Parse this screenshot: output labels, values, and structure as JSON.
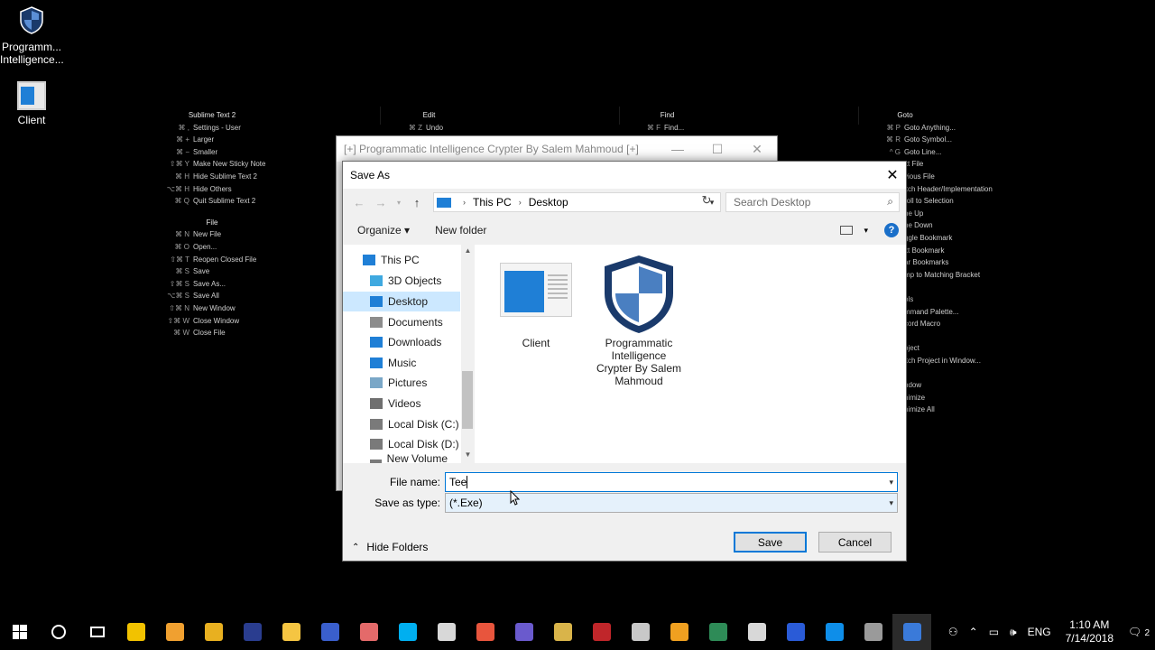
{
  "desktop": {
    "icons": [
      {
        "label": "Programm... Intelligence...",
        "icon": "shield-icon"
      },
      {
        "label": "Client",
        "icon": "window-app-icon"
      }
    ]
  },
  "sublime_overlay": {
    "col1": {
      "head": "Sublime Text 2",
      "rows": [
        {
          "key": "⌘ ,",
          "label": "Settings - User"
        },
        {
          "key": "⌘ +",
          "label": "Larger"
        },
        {
          "key": "⌘ −",
          "label": "Smaller"
        },
        {
          "key": "⇧⌘ Y",
          "label": "Make New Sticky Note"
        },
        {
          "key": "⌘ H",
          "label": "Hide Sublime Text 2"
        },
        {
          "key": "⌥⌘ H",
          "label": "Hide Others"
        },
        {
          "key": "⌘ Q",
          "label": "Quit Sublime Text 2"
        }
      ],
      "head2": "File",
      "rows2": [
        {
          "key": "⌘ N",
          "label": "New File"
        },
        {
          "key": "⌘ O",
          "label": "Open..."
        },
        {
          "key": "⇧⌘ T",
          "label": "Reopen Closed File"
        },
        {
          "key": "⌘ S",
          "label": "Save"
        },
        {
          "key": "⇧⌘ S",
          "label": "Save As..."
        },
        {
          "key": "⌥⌘ S",
          "label": "Save All"
        },
        {
          "key": "⇧⌘ N",
          "label": "New Window"
        },
        {
          "key": "⇧⌘ W",
          "label": "Close Window"
        },
        {
          "key": "⌘ W",
          "label": "Close File"
        }
      ]
    },
    "col2": {
      "head": "Edit",
      "rows": [
        {
          "key": "⌘ Z",
          "label": "Undo"
        }
      ]
    },
    "col3": {
      "head": "Find",
      "rows": [
        {
          "key": "⌘ F",
          "label": "Find..."
        }
      ]
    },
    "col4": {
      "head": "Goto",
      "rows": [
        {
          "key": "⌘ P",
          "label": "Goto Anything..."
        },
        {
          "key": "⌘ R",
          "label": "Goto Symbol..."
        },
        {
          "key": "^ G",
          "label": "Goto Line..."
        },
        {
          "key": "",
          "label": "xt File"
        },
        {
          "key": "",
          "label": "vious File"
        },
        {
          "key": "",
          "label": "itch Header/Implementation"
        },
        {
          "key": "",
          "label": "roll to Selection"
        },
        {
          "key": "",
          "label": "ne Up"
        },
        {
          "key": "",
          "label": "ne Down"
        },
        {
          "key": "",
          "label": "ggle Bookmark"
        },
        {
          "key": "",
          "label": "xt Bookmark"
        },
        {
          "key": "",
          "label": "ar Bookmarks"
        },
        {
          "key": "",
          "label": "mp to Matching Bracket"
        },
        {
          "key": "",
          "label": ""
        },
        {
          "key": "",
          "label": "ols"
        },
        {
          "key": "",
          "label": "mmand Palette..."
        },
        {
          "key": "",
          "label": "cord Macro"
        },
        {
          "key": "",
          "label": ""
        },
        {
          "key": "",
          "label": "oject"
        },
        {
          "key": "",
          "label": "itch Project in Window..."
        },
        {
          "key": "",
          "label": ""
        },
        {
          "key": "",
          "label": "ndow"
        },
        {
          "key": "",
          "label": "nimize"
        },
        {
          "key": "",
          "label": "nimize All"
        }
      ]
    }
  },
  "bg_window": {
    "title": "[+] Programmatic Intelligence Crypter By Salem Mahmoud [+]"
  },
  "dialog": {
    "title": "Save As",
    "address": {
      "root": "This PC",
      "current": "Desktop"
    },
    "search_placeholder": "Search Desktop",
    "toolbar": {
      "organize": "Organize ▾",
      "new_folder": "New folder",
      "help": "?"
    },
    "nav": [
      {
        "label": "This PC",
        "icon": "pc-icon",
        "color": "#1f7fd6"
      },
      {
        "label": "3D Objects",
        "icon": "cube-icon",
        "color": "#3fa9e0"
      },
      {
        "label": "Desktop",
        "icon": "desktop-icon",
        "color": "#1f7fd6",
        "selected": true
      },
      {
        "label": "Documents",
        "icon": "documents-icon",
        "color": "#8c8c8c"
      },
      {
        "label": "Downloads",
        "icon": "download-icon",
        "color": "#1f7fd6"
      },
      {
        "label": "Music",
        "icon": "music-icon",
        "color": "#1f7fd6"
      },
      {
        "label": "Pictures",
        "icon": "pictures-icon",
        "color": "#7aa7c7"
      },
      {
        "label": "Videos",
        "icon": "videos-icon",
        "color": "#6f6f6f"
      },
      {
        "label": "Local Disk (C:)",
        "icon": "disk-icon",
        "color": "#7a7a7a"
      },
      {
        "label": "Local Disk (D:)",
        "icon": "disk-icon",
        "color": "#7a7a7a"
      },
      {
        "label": "New Volume (E:)",
        "icon": "disk-icon",
        "color": "#7a7a7a"
      }
    ],
    "files": [
      {
        "label": "Client",
        "icon": "window-app-icon"
      },
      {
        "label": "Programmatic Intelligence Crypter By Salem Mahmoud",
        "icon": "shield-icon"
      }
    ],
    "file_name_label": "File name:",
    "file_name_value": "Tee",
    "save_type_label": "Save as type:",
    "save_type_value": "(*.Exe)",
    "hide_folders": "Hide Folders",
    "save_button": "Save",
    "cancel_button": "Cancel"
  },
  "taskbar": {
    "apps": [
      {
        "name": "file-explorer-icon",
        "color": "#f2c200"
      },
      {
        "name": "weibo-icon",
        "color": "#f0a030"
      },
      {
        "name": "app-yellow-icon",
        "color": "#e8b020"
      },
      {
        "name": "nt-app-icon",
        "color": "#2a3d8f"
      },
      {
        "name": "media-icon",
        "color": "#f5c542"
      },
      {
        "name": "network-app-icon",
        "color": "#3a5fcd"
      },
      {
        "name": "paint-icon",
        "color": "#e46a6a"
      },
      {
        "name": "skype-icon",
        "color": "#00aff0"
      },
      {
        "name": "xml-editor-icon",
        "color": "#d8d8d8"
      },
      {
        "name": "c-app-icon",
        "color": "#e8553d"
      },
      {
        "name": "link-app-icon",
        "color": "#6a5acd"
      },
      {
        "name": "r-app-icon",
        "color": "#d9b44a"
      },
      {
        "name": "cluster-app-icon",
        "color": "#c0262a"
      },
      {
        "name": "multi-window-icon",
        "color": "#c8c8c8"
      },
      {
        "name": "de-app-icon",
        "color": "#f0a020"
      },
      {
        "name": "excel-icon",
        "color": "#2e8b57"
      },
      {
        "name": "calculator-icon",
        "color": "#d8d8d8"
      },
      {
        "name": "exe-app-icon",
        "color": "#2a5bd7"
      },
      {
        "name": "teamviewer-icon",
        "color": "#0e8ee9"
      },
      {
        "name": "pen-app-icon",
        "color": "#9a9a9a"
      },
      {
        "name": "active-app-icon",
        "color": "#3a7ad9"
      }
    ],
    "lang": "ENG",
    "time": "1:10 AM",
    "date": "7/14/2018",
    "notif_count": "2"
  }
}
